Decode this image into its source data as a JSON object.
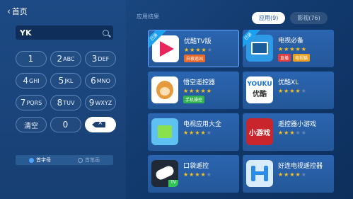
{
  "header": {
    "back_label": "首页"
  },
  "search": {
    "query": "YK"
  },
  "keypad": [
    {
      "num": "1",
      "letters": ""
    },
    {
      "num": "2",
      "letters": "ABC"
    },
    {
      "num": "3",
      "letters": "DEF"
    },
    {
      "num": "4",
      "letters": "GHI"
    },
    {
      "num": "5",
      "letters": "JKL"
    },
    {
      "num": "6",
      "letters": "MNO"
    },
    {
      "num": "7",
      "letters": "PQRS"
    },
    {
      "num": "8",
      "letters": "TUV"
    },
    {
      "num": "9",
      "letters": "WXYZ"
    },
    {
      "num": "清空",
      "letters": ""
    },
    {
      "num": "0",
      "letters": ""
    }
  ],
  "input_modes": {
    "pinyin": "首字母",
    "stroke": "首笔画"
  },
  "results": {
    "section_label": "应用结果",
    "tabs": {
      "apps": "应用(9)",
      "videos": "影视(76)"
    }
  },
  "apps": [
    {
      "name": "优酷TV版",
      "stars": 4,
      "ribbon": "已装",
      "badges": [
        {
          "text": "白夜追凶",
          "color": "#e8692a"
        }
      ]
    },
    {
      "name": "电视必备",
      "stars": 5,
      "ribbon": "已装",
      "badges": [
        {
          "text": "直播",
          "color": "#e23d3d"
        },
        {
          "text": "电视猫",
          "color": "#e8a020"
        }
      ]
    },
    {
      "name": "悟空遥控器",
      "stars": 5,
      "ribbon": "",
      "badges": [
        {
          "text": "手机操控",
          "color": "#32b34f"
        }
      ]
    },
    {
      "name": "优酷XL",
      "stars": 4,
      "ribbon": "",
      "badges": []
    },
    {
      "name": "电视应用大全",
      "stars": 4,
      "ribbon": "",
      "badges": []
    },
    {
      "name": "遥控器小游戏",
      "stars": 3,
      "ribbon": "",
      "badges": []
    },
    {
      "name": "口袋遥控",
      "stars": 4,
      "ribbon": "",
      "badges": []
    },
    {
      "name": "好连电视遥控器",
      "stars": 4,
      "ribbon": "",
      "badges": []
    }
  ],
  "icon_text": {
    "ykxl_top": "YOUKU",
    "ykxl_bottom": "优酷",
    "game": "小游戏",
    "remote_tag": "TV"
  },
  "colors": {
    "accent": "#1aa1ef",
    "star": "#ffc21a",
    "card": "#2b65b0"
  }
}
